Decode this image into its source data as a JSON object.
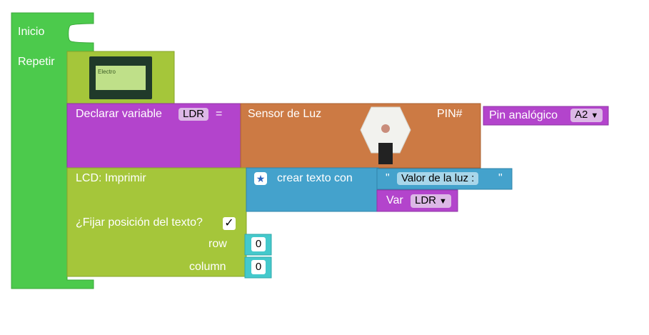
{
  "blocks": {
    "inicio_label": "Inicio",
    "repetir_label": "Repetir",
    "lcd_image_text": "Electro",
    "declare": {
      "label": "Declarar variable",
      "var_name": "LDR",
      "equals": "="
    },
    "sensor": {
      "label": "Sensor de Luz",
      "pin_label": "PIN#"
    },
    "pin": {
      "label": "Pin analógico",
      "value": "A2"
    },
    "lcd": {
      "label": "LCD: Imprimir",
      "position_label": "¿Fijar posición del texto?",
      "position_checked": "✓",
      "row_label": "row",
      "row_value": "0",
      "column_label": "column",
      "column_value": "0"
    },
    "text_create": {
      "label": "crear texto con",
      "star": "★"
    },
    "text_literal": {
      "open_quote": "\"",
      "value": "Valor de la luz :",
      "close_quote": "\""
    },
    "var_getter": {
      "label": "Var",
      "value": "LDR"
    },
    "dropdown_arrow": "▼"
  },
  "colors": {
    "control": "#4cca4c",
    "lcd_block": "#a5c63a",
    "variable": "#b344cc",
    "sensor": "#cc7a44",
    "text": "#44a2cc",
    "math": "#44c9cc"
  }
}
